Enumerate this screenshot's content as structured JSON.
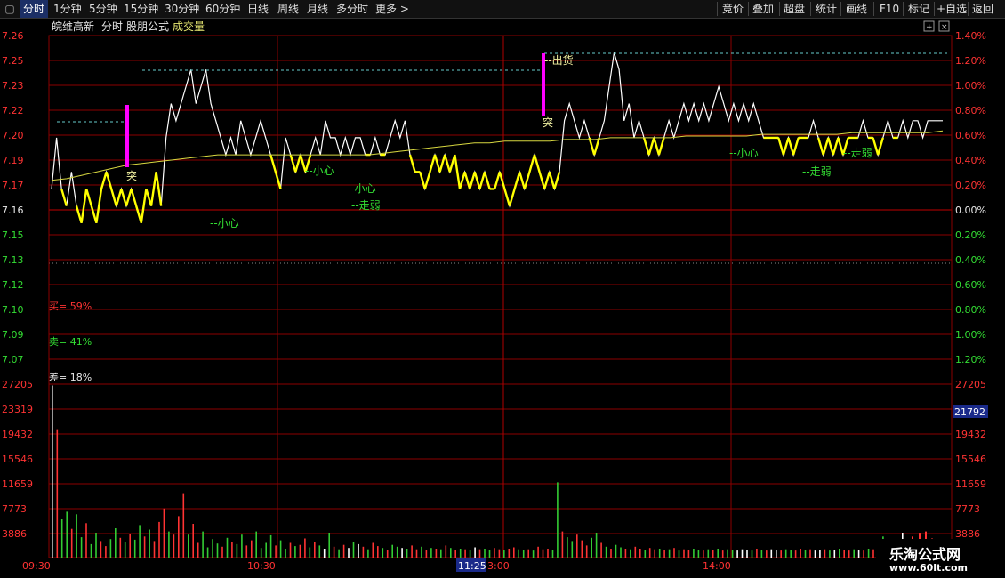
{
  "toolbar": {
    "left_items": [
      "分时",
      "1分钟",
      "5分钟",
      "15分钟",
      "30分钟",
      "60分钟",
      "日线",
      "周线",
      "月线",
      "多分时",
      "更多 >"
    ],
    "right_items": [
      "竞价",
      "叠加",
      "超盘",
      "统计",
      "画线",
      "F10",
      "标记",
      "+自选",
      "返回"
    ]
  },
  "header": {
    "stock_name": "皖维高新",
    "mode": "分时",
    "formula": "股朋公式",
    "indicator": "成交量"
  },
  "axes": {
    "price_ticks": [
      "7.26",
      "7.25",
      "7.23",
      "7.22",
      "7.20",
      "7.19",
      "7.17",
      "7.16",
      "7.15",
      "7.13",
      "7.12",
      "7.10",
      "7.09",
      "7.07"
    ],
    "pct_ticks": [
      "1.40%",
      "1.20%",
      "1.00%",
      "0.80%",
      "0.60%",
      "0.40%",
      "0.20%",
      "0.00%",
      "0.20%",
      "0.40%",
      "0.60%",
      "0.80%",
      "1.00%",
      "1.20%"
    ],
    "volume_ticks": [
      "27205",
      "23319",
      "19432",
      "15546",
      "11659",
      "7773",
      "3886"
    ],
    "time_ticks": [
      "09:30",
      "10:30",
      "11:25",
      "14:00"
    ],
    "time_ticks_right": [
      "3:00"
    ],
    "current_volume": "21792",
    "current_volume_right": "3886"
  },
  "stats": {
    "buy": "买= 59%",
    "sell": "卖= 41%",
    "diff": "差= 18%"
  },
  "annotations": {
    "tu1": "突",
    "tu2": "突",
    "chuhuo": "--出货",
    "xiaoxin": "--小心",
    "zouruo": "--走弱"
  },
  "watermark": {
    "name": "乐淘公式网",
    "url": "www.60lt.com"
  },
  "colors": {
    "grid": "#8b0000",
    "price_up": "#ff3333",
    "price_down": "#33dd33",
    "price_line": "#ffffff",
    "highlight": "#ffff00",
    "avg_line": "#d8d840",
    "signal": "#ff00ff",
    "vol_up": "#ff3333",
    "vol_down": "#33cc33",
    "vol_flat": "#ffffff"
  },
  "chart_data": {
    "type": "line",
    "title": "",
    "xlabel": "",
    "ylabel": "",
    "ylim": [
      7.07,
      7.26
    ],
    "price_base": 7.16,
    "series": [
      {
        "values": [
          7.17,
          7.2,
          7.17,
          7.16,
          7.18,
          7.16,
          7.15,
          7.17,
          7.16,
          7.15,
          7.17,
          7.18,
          7.17,
          7.16,
          7.17,
          7.16,
          7.17,
          7.16,
          7.15,
          7.17,
          7.16,
          7.18,
          7.16,
          7.2,
          7.22,
          7.21,
          7.22,
          7.23,
          7.24,
          7.22,
          7.23,
          7.24,
          7.22,
          7.21,
          7.2,
          7.19,
          7.2,
          7.19,
          7.21,
          7.2,
          7.19,
          7.2,
          7.21,
          7.2,
          7.19,
          7.18,
          7.17,
          7.2,
          7.19,
          7.18,
          7.19,
          7.18,
          7.19,
          7.2,
          7.19,
          7.21,
          7.2,
          7.2,
          7.19,
          7.2,
          7.19,
          7.2,
          7.2,
          7.19,
          7.19,
          7.2,
          7.19,
          7.19,
          7.2,
          7.21,
          7.2,
          7.21,
          7.19,
          7.18,
          7.18,
          7.17,
          7.18,
          7.19,
          7.18,
          7.19,
          7.18,
          7.19,
          7.17,
          7.18,
          7.17,
          7.18,
          7.17,
          7.18,
          7.17,
          7.17,
          7.18,
          7.17,
          7.16,
          7.17,
          7.18,
          7.17,
          7.18,
          7.19,
          7.18,
          7.17,
          7.18,
          7.17,
          7.18,
          7.21,
          7.22,
          7.21,
          7.2,
          7.21,
          7.2,
          7.19,
          7.2,
          7.21,
          7.23,
          7.25,
          7.24,
          7.21,
          7.22,
          7.2,
          7.21,
          7.2,
          7.19,
          7.2,
          7.19,
          7.2,
          7.21,
          7.2,
          7.21,
          7.22,
          7.21,
          7.22,
          7.21,
          7.22,
          7.21,
          7.22,
          7.23,
          7.22,
          7.21,
          7.22,
          7.21,
          7.22,
          7.21,
          7.22,
          7.21,
          7.2,
          7.2,
          7.2,
          7.2,
          7.19,
          7.2,
          7.19,
          7.2,
          7.2,
          7.2,
          7.21,
          7.2,
          7.19,
          7.2,
          7.19,
          7.2,
          7.19,
          7.2,
          7.2,
          7.2,
          7.21,
          7.2,
          7.2,
          7.19,
          7.2,
          7.21,
          7.2,
          7.2,
          7.21,
          7.2,
          7.21,
          7.21,
          7.2,
          7.21,
          7.21,
          7.21,
          7.21
        ]
      },
      {
        "values": [
          7.175,
          7.176,
          7.178,
          7.18,
          7.182,
          7.184,
          7.185,
          7.186,
          7.187,
          7.188,
          7.189,
          7.19,
          7.19,
          7.19,
          7.19,
          7.19,
          7.19,
          7.19,
          7.19,
          7.19,
          7.19,
          7.19,
          7.191,
          7.192,
          7.193,
          7.194,
          7.195,
          7.196,
          7.197,
          7.197,
          7.198,
          7.198,
          7.198,
          7.198,
          7.199,
          7.199,
          7.199,
          7.2,
          7.2,
          7.2,
          7.2,
          7.2,
          7.201,
          7.201,
          7.201,
          7.201,
          7.201,
          7.202,
          7.202,
          7.202,
          7.202,
          7.202,
          7.202,
          7.203,
          7.203,
          7.203,
          7.203,
          7.203,
          7.203,
          7.204
        ]
      }
    ],
    "volume": {
      "ylim": [
        0,
        27205
      ],
      "values": [
        27000,
        20000,
        6000,
        7200,
        4500,
        6800,
        3200,
        5400,
        2100,
        3900,
        2600,
        1800,
        2900,
        4600,
        3100,
        2400,
        3700,
        2800,
        5100,
        3300,
        4400,
        2600,
        5600,
        7700,
        4100,
        3600,
        6500,
        10100,
        3600,
        5300,
        2300,
        4100,
        1600,
        2900,
        2200,
        1700,
        3100,
        2500,
        2100,
        3600,
        1900,
        2700,
        4100,
        1500,
        2300,
        3500,
        1900,
        2700,
        1400,
        2300,
        1800,
        2000,
        3000,
        1600,
        2400,
        1900,
        1400,
        3900,
        1700,
        1300,
        2000,
        1500,
        2500,
        2100,
        1700,
        1300,
        2300,
        1800,
        1500,
        1200,
        2000,
        1700,
        1500,
        1400,
        1900,
        1300,
        1700,
        1200,
        1500,
        1400,
        1300,
        1900,
        1500,
        1200,
        1400,
        1300,
        1200,
        1600,
        1300,
        1400,
        1200,
        1500,
        1300,
        1200,
        1400,
        1600,
        1300,
        1200,
        1300,
        1100,
        1700,
        1300,
        1400,
        1200,
        11800,
        4100,
        3200,
        2600,
        3600,
        2700,
        1900,
        3100,
        3900,
        2300,
        1700,
        1400,
        2000,
        1600,
        1400,
        1300,
        1700,
        1400,
        1200,
        1500,
        1300,
        1400,
        1200,
        1300,
        1500,
        1100,
        1300,
        1200,
        1400,
        1200,
        1100,
        1300,
        1200,
        1400,
        1100,
        1300,
        1200,
        1100,
        1300,
        1200,
        1100,
        1400,
        1200,
        1100,
        1300,
        1200,
        1100,
        1300,
        1200,
        1100,
        1400,
        1200,
        1300,
        1100,
        1200,
        1300,
        1100,
        1200,
        1400,
        1200,
        1100,
        1300,
        1200,
        1100,
        1400,
        1300,
        1200,
        3300,
        1600,
        1200,
        2500,
        3900
      ]
    }
  }
}
